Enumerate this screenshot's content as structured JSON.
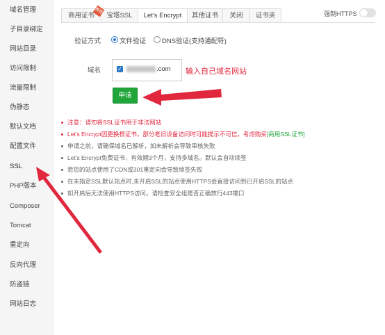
{
  "sidebar": {
    "items": [
      {
        "label": "域名管理"
      },
      {
        "label": "子目录绑定"
      },
      {
        "label": "网站目录"
      },
      {
        "label": "访问限制"
      },
      {
        "label": "流量限制"
      },
      {
        "label": "伪静态"
      },
      {
        "label": "默认文档"
      },
      {
        "label": "配置文件"
      },
      {
        "label": "SSL"
      },
      {
        "label": "PHP版本"
      },
      {
        "label": "Composer"
      },
      {
        "label": "Tomcat"
      },
      {
        "label": "重定向"
      },
      {
        "label": "反向代理"
      },
      {
        "label": "防盗链"
      },
      {
        "label": "网站日志"
      }
    ]
  },
  "tabs": [
    {
      "label": "商用证书"
    },
    {
      "label": "宝塔SSL"
    },
    {
      "label": "Let's Encrypt"
    },
    {
      "label": "其他证书"
    },
    {
      "label": "关闭"
    },
    {
      "label": "证书夹"
    }
  ],
  "ribbon": "推荐",
  "force_https": {
    "label": "强制HTTPS",
    "enabled": false
  },
  "form": {
    "verify_label": "验证方式",
    "verify_options": [
      {
        "label": "文件验证",
        "selected": true
      },
      {
        "label": "DNS验证(支持通配符)",
        "selected": false
      }
    ],
    "domain_label": "域名",
    "domain_suffix": ".com",
    "domain_checked": true,
    "apply_label": "申请"
  },
  "annotation": "输入自己域名网站",
  "tips": [
    {
      "text": "注意：请勿将SSL证书用于非法网站",
      "highlight": true
    },
    {
      "text": "Let's Encrypt因更换根证书，部分老旧设备访问时可能提示不可信，考虑购买",
      "link": "[商用SSL证书]",
      "highlight": true
    },
    {
      "text": "申请之前，请确保域名已解析，如未解析会导致审核失败"
    },
    {
      "text": "Let's Encrypt免费证书，有效期3个月，支持多域名。默认会自动续签"
    },
    {
      "text": "若您的站点使用了CDN或301重定向会导致续签失败"
    },
    {
      "text": "在未指定SSL默认站点时,未开启SSL的站点使用HTTPS会直接访问到已开启SSL的站点"
    },
    {
      "text": "如开启后无法使用HTTPS访问，请检查安全组是否正确放行443端口"
    }
  ],
  "colors": {
    "accent": "#20a53a",
    "annotation": "#e0273d",
    "link": "#2b79c7"
  }
}
